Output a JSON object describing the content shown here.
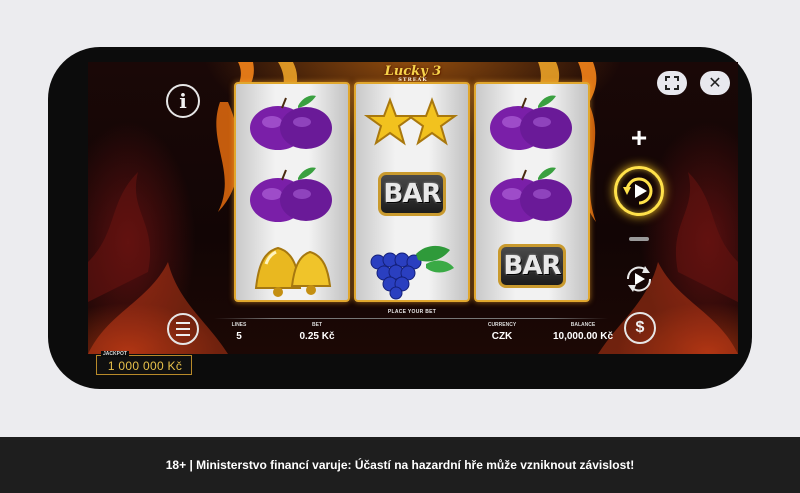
{
  "game": {
    "logo_title": "Lucky 3",
    "logo_subtitle": "STREAK"
  },
  "reels": [
    [
      "plum",
      "plum",
      "bell"
    ],
    [
      "star",
      "bar",
      "grapes"
    ],
    [
      "plum",
      "plum",
      "bar"
    ]
  ],
  "symbols": {
    "bar_label": "BAR"
  },
  "hud": {
    "place_bet_label": "PLACE YOUR BET",
    "lines_label": "LINES",
    "lines_value": "5",
    "bet_label": "BET",
    "bet_value": "0.25 Kč",
    "currency_label": "CURRENCY",
    "currency_value": "CZK",
    "balance_label": "BALANCE",
    "balance_value": "10,000.00 Kč"
  },
  "controls": {
    "info_glyph": "i",
    "plus_glyph": "+",
    "dollar_glyph": "$",
    "close_glyph": "✕",
    "icons": [
      "info-icon",
      "fullscreen-icon",
      "close-icon",
      "menu-icon",
      "spin-icon",
      "autoplay-icon",
      "dollar-icon"
    ]
  },
  "jackpot": {
    "label": "JACKPOT",
    "value": "1 000 000 Kč"
  },
  "footer": {
    "disclaimer": "18+ | Ministerstvo financí varuje: Účastí na hazardní hře může vzniknout závislost!"
  },
  "colors": {
    "reel_border": "#e0a72e",
    "spin_ring": "#ffe14a",
    "jackpot_text": "#e7c04a",
    "footer_bg": "#1e1e1e"
  }
}
